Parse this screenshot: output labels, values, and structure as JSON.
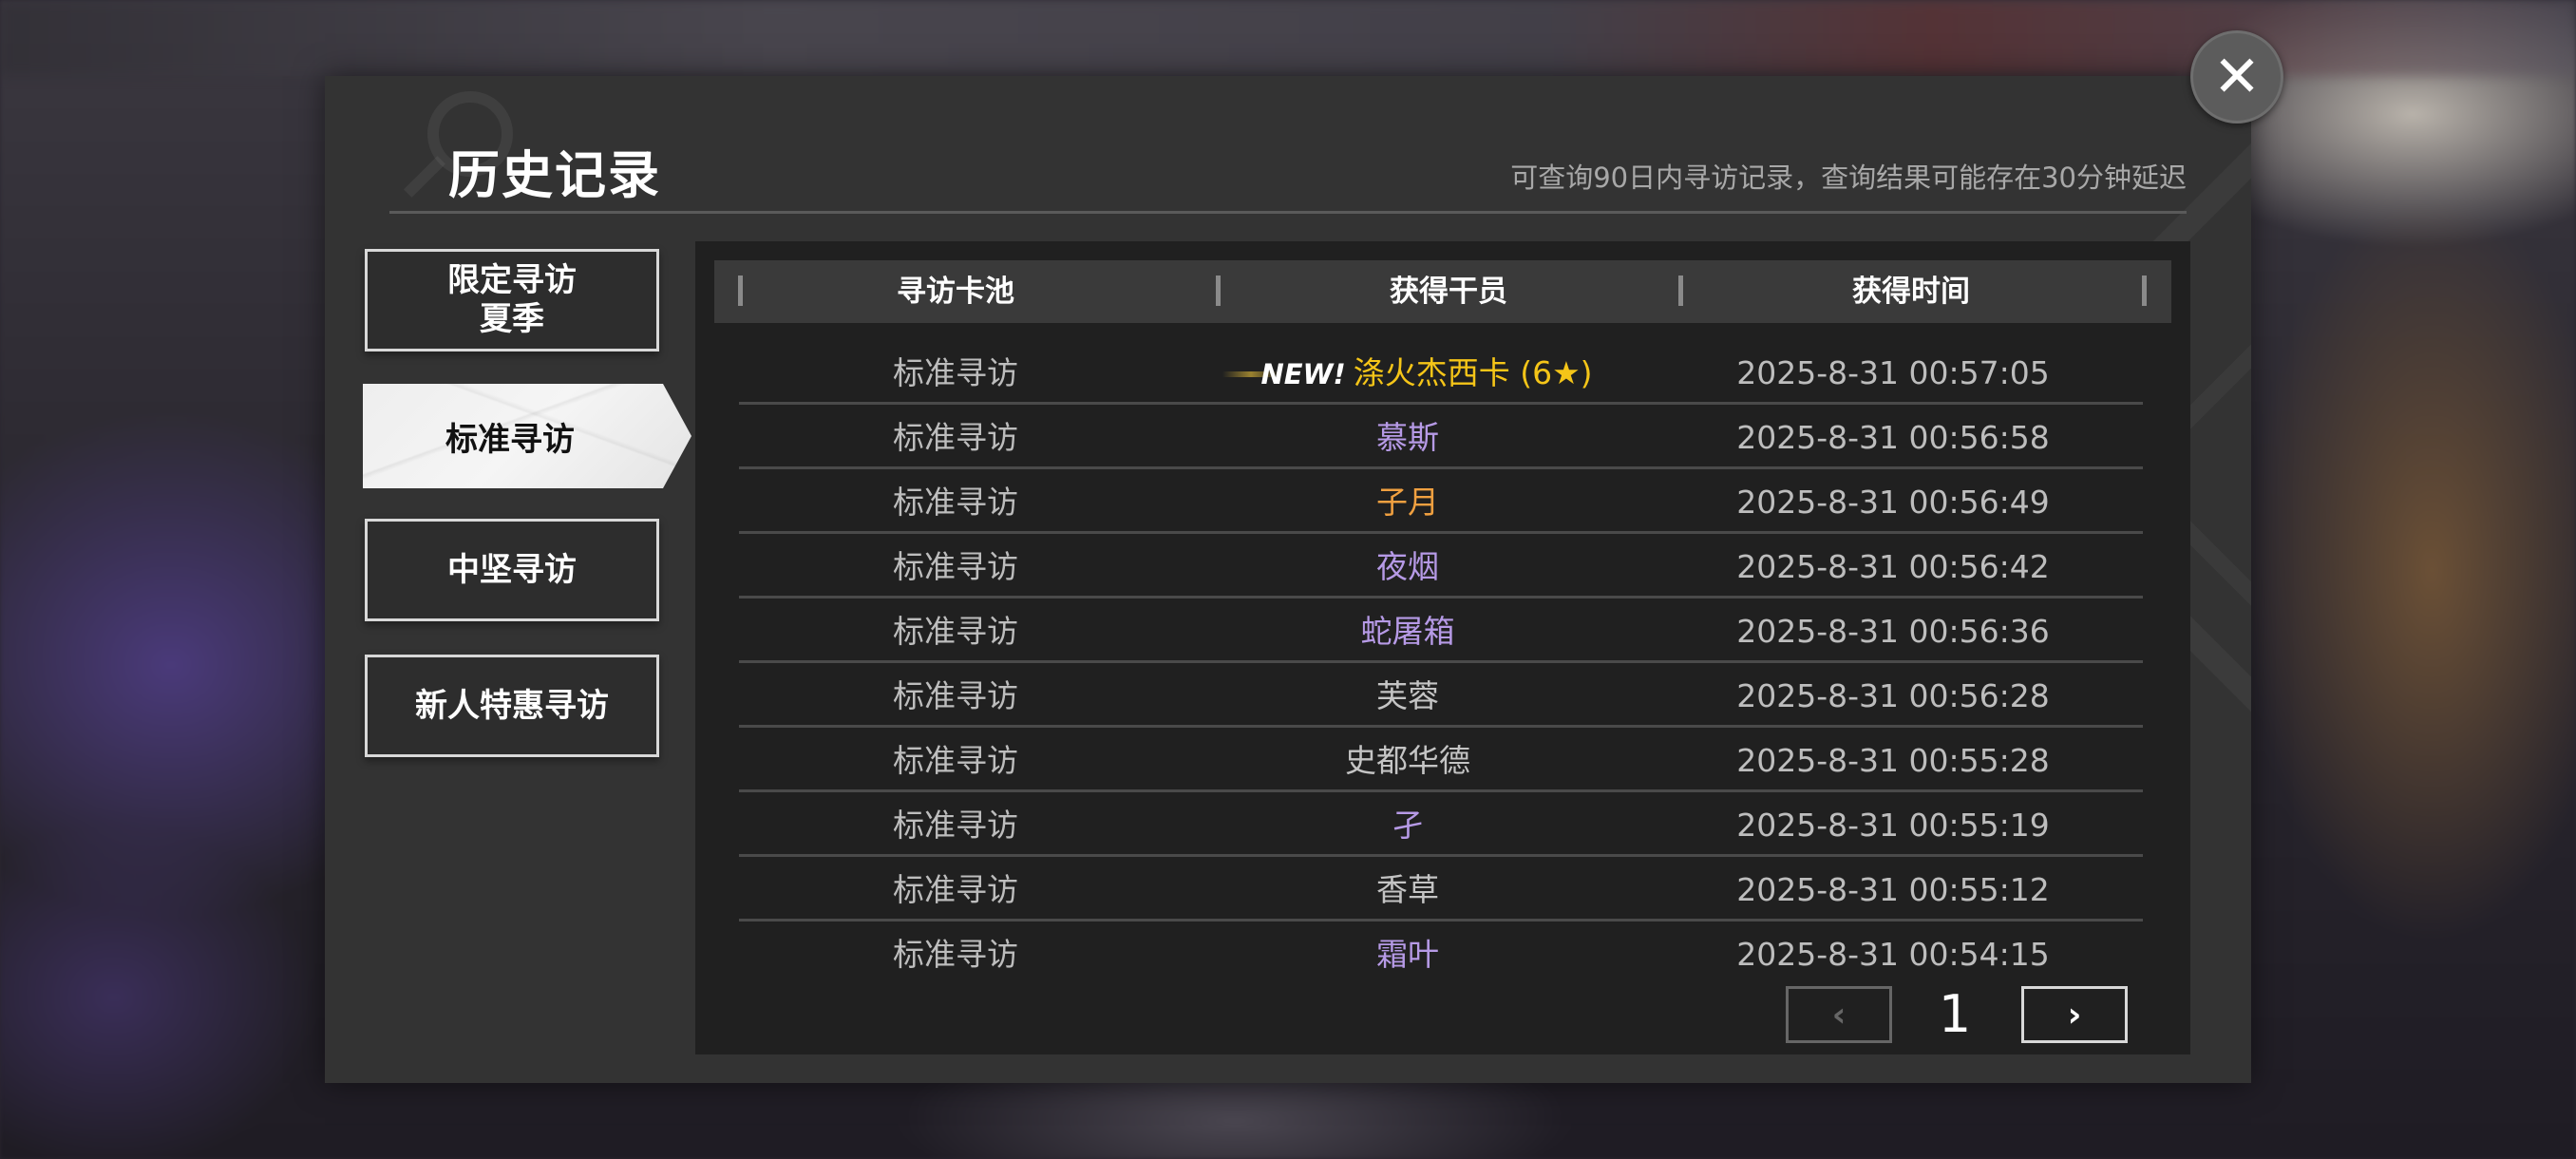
{
  "header": {
    "title": "历史记录",
    "hint": "可查询90日内寻访记录，查询结果可能存在30分钟延迟",
    "close_icon": "✕"
  },
  "tabs": [
    {
      "label": "限定寻访\n夏季",
      "active": false
    },
    {
      "label": "标准寻访",
      "active": true
    },
    {
      "label": "中坚寻访",
      "active": false
    },
    {
      "label": "新人特惠寻访",
      "active": false
    }
  ],
  "table": {
    "headers": [
      "寻访卡池",
      "获得干员",
      "获得时间"
    ],
    "rows": [
      {
        "pool": "标准寻访",
        "badge": "NEW!",
        "operator": "涤火杰西卡 (6★)",
        "rarity": "gold",
        "time": "2025-8-31 00:57:05"
      },
      {
        "pool": "标准寻访",
        "badge": "",
        "operator": "慕斯",
        "rarity": "purple",
        "time": "2025-8-31 00:56:58"
      },
      {
        "pool": "标准寻访",
        "badge": "",
        "operator": "子月",
        "rarity": "orange",
        "time": "2025-8-31 00:56:49"
      },
      {
        "pool": "标准寻访",
        "badge": "",
        "operator": "夜烟",
        "rarity": "purple",
        "time": "2025-8-31 00:56:42"
      },
      {
        "pool": "标准寻访",
        "badge": "",
        "operator": "蛇屠箱",
        "rarity": "purple",
        "time": "2025-8-31 00:56:36"
      },
      {
        "pool": "标准寻访",
        "badge": "",
        "operator": "芙蓉",
        "rarity": "gray",
        "time": "2025-8-31 00:56:28"
      },
      {
        "pool": "标准寻访",
        "badge": "",
        "operator": "史都华德",
        "rarity": "gray",
        "time": "2025-8-31 00:55:28"
      },
      {
        "pool": "标准寻访",
        "badge": "",
        "operator": "孑",
        "rarity": "purple",
        "time": "2025-8-31 00:55:19"
      },
      {
        "pool": "标准寻访",
        "badge": "",
        "operator": "香草",
        "rarity": "gray",
        "time": "2025-8-31 00:55:12"
      },
      {
        "pool": "标准寻访",
        "badge": "",
        "operator": "霜叶",
        "rarity": "purple",
        "time": "2025-8-31 00:54:15"
      }
    ]
  },
  "pager": {
    "prev_icon": "‹",
    "next_icon": "›",
    "page": "1"
  },
  "colors": {
    "gold": "#f5c518",
    "purple": "#b69ae6",
    "orange": "#f0a040",
    "gray": "#c4c4c4"
  }
}
